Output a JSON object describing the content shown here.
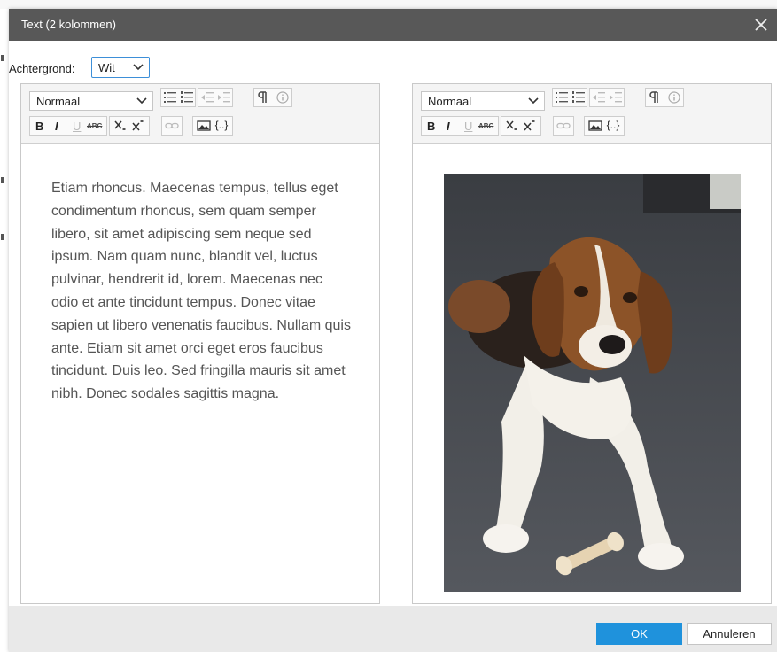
{
  "dialog": {
    "title": "Text (2 kolommen)"
  },
  "background": {
    "label": "Achtergrond:",
    "value": "Wit"
  },
  "toolbar": {
    "format_value": "Normaal",
    "bold": "B",
    "italic": "I",
    "underline": "U",
    "strike": "ABC",
    "snippet": "{..}"
  },
  "left_editor": {
    "text": "Etiam rhoncus. Maecenas tempus, tellus eget condimentum rhoncus, sem quam semper libero, sit amet adipiscing sem neque sed ipsum. Nam quam nunc, blandit vel, luctus pulvinar, hendrerit id, lorem. Maecenas nec odio et ante tincidunt tempus. Donec vitae sapien ut libero venenatis faucibus. Nullam quis ante. Etiam sit amet orci eget eros faucibus tincidunt. Duis leo. Sed fringilla mauris sit amet nibh. Donec sodales sagittis magna."
  },
  "footer": {
    "ok_label": "OK",
    "cancel_label": "Annuleren"
  },
  "colors": {
    "titlebar": "#585858",
    "accent": "#1f92dc",
    "footer": "#e9e9e9"
  },
  "icons": [
    "close-icon",
    "chevron-down-icon",
    "bullet-list-icon",
    "numbered-list-icon",
    "outdent-icon",
    "indent-icon",
    "pilcrow-icon",
    "info-icon",
    "subscript-icon",
    "superscript-icon",
    "link-icon",
    "image-icon"
  ]
}
